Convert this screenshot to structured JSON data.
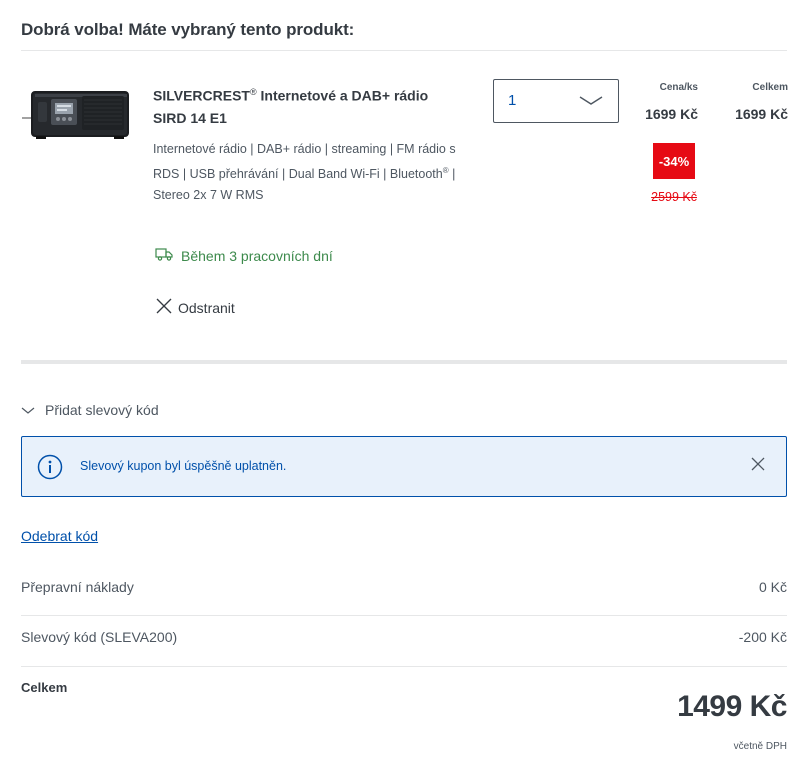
{
  "heading": "Dobrá volba! Máte vybraný tento produkt:",
  "product": {
    "name_brand": "SILVERCREST",
    "name_reg": "®",
    "name_rest": " Internetové a DAB+ rádio SIRD 14 E1",
    "description_part1": "Internetové rádio | DAB+ rádio | streaming | FM rádio s RDS | USB přehrávání | Dual Band Wi-Fi | Bluetooth",
    "description_reg": "®",
    "description_part2": " | Stereo 2x 7 W RMS",
    "image_icon": "radio-product-image"
  },
  "quantity": {
    "value": "1",
    "icon": "chevron-down-icon"
  },
  "columns": {
    "unit_price_header": "Cena/ks",
    "total_header": "Celkem"
  },
  "prices": {
    "unit_price": "1699 Kč",
    "line_total": "1699 Kč",
    "discount_badge": "-34%",
    "old_price": "2599 Kč"
  },
  "delivery": {
    "text": "Během 3 pracovních dní",
    "icon": "truck-icon"
  },
  "remove": {
    "label": "Odstranit",
    "icon": "close-icon"
  },
  "coupon": {
    "toggle_label": "Přidat slevový kód",
    "toggle_icon": "chevron-down-icon",
    "alert_text": "Slevový kupon byl úspěšně uplatněn.",
    "alert_icon": "info-icon",
    "alert_close_icon": "close-icon",
    "remove_code_label": "Odebrat kód"
  },
  "summary": {
    "shipping_label": "Přepravní náklady",
    "shipping_value": "0 Kč",
    "discount_label": "Slevový kód (SLEVA200)",
    "discount_value": "-200 Kč",
    "total_label": "Celkem",
    "total_value": "1499 Kč",
    "vat_note": "včetně DPH"
  },
  "colors": {
    "brand_blue": "#0050aa",
    "discount_red": "#e60a14",
    "delivery_green": "#3d8a4c",
    "text": "#353b42",
    "alert_bg": "#e8f1fb"
  }
}
